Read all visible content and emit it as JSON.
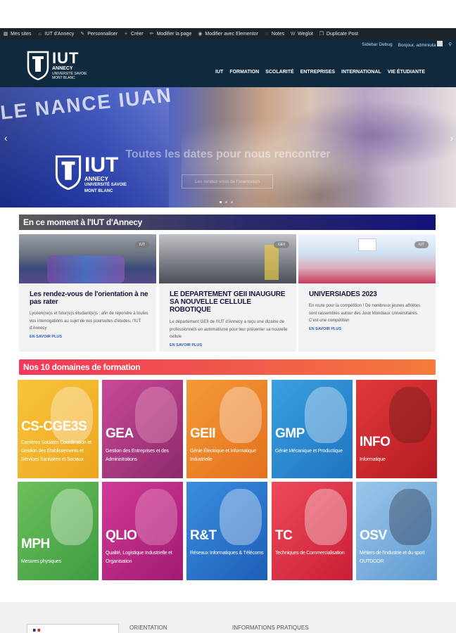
{
  "adminbar": {
    "items": [
      {
        "label": "Mes sites",
        "icon": "sites-icon"
      },
      {
        "label": "IUT d'Annecy",
        "icon": "home-icon"
      },
      {
        "label": "Personnaliser",
        "icon": "brush-icon"
      },
      {
        "label": "Créer",
        "icon": "plus-icon"
      },
      {
        "label": "Modifier la page",
        "icon": "pencil-icon"
      },
      {
        "label": "Modifier avec Elementor",
        "icon": "elementor-icon"
      },
      {
        "label": "Notes",
        "icon": "comment-icon"
      },
      {
        "label": "Weglot",
        "icon": "weglot-icon"
      },
      {
        "label": "Duplicate Post",
        "icon": "copy-icon"
      }
    ]
  },
  "subbar": {
    "debug": "Sidebar Debug",
    "greeting": "Bonjour, adminiuta"
  },
  "logo": {
    "name": "IUT",
    "sub1": "ANNECY",
    "sub2": "UNIVERSITÉ SAVOIE",
    "sub3": "MONT BLANC"
  },
  "nav": [
    "IUT",
    "FORMATION",
    "SCOLARITÉ",
    "ENTREPRISES",
    "INTERNATIONAL",
    "VIE ÉTUDIANTE"
  ],
  "hero": {
    "title": "Toutes les dates pour nous rencontrer",
    "button": "Les rendez-vous de l'orientation",
    "banner": "LE NANCE IUAN",
    "logo_name": "IUT",
    "logo_sub1": "ANNECY",
    "logo_sub2": "UNIVERSITÉ SAVOIE",
    "logo_sub3": "MONT BLANC"
  },
  "news": {
    "heading": "En ce moment à l'IUT d'Annecy",
    "cards": [
      {
        "tag": "IUT",
        "title": "Les rendez-vous de l'orientation à ne pas rater",
        "desc": "Lycéen(ne)s et futur(e)s étudiant(e)s : afin de répondre à toutes vos interrogations au sujet de vos poursuites d'études, l'IUT d'Annecy",
        "more": "EN SAVOIR PLUS"
      },
      {
        "tag": "GEII",
        "title": "LE DEPARTEMENT GEII INAUGURE SA NOUVELLE CELLULE ROBOTIQUE",
        "desc": "Le département GEII de l'IUT d'Annecy a reçu une dizaine de professionnels en automatisme pour leur présenter sa nouvelle cellule",
        "more": "EN SAVOIR PLUS"
      },
      {
        "tag": "IUT",
        "title": "UNIVERSIADES 2023",
        "desc": "En route pour la compétition ! De nombreux jeunes athlètes sont rassemblés autour des Jeux Mondiaux Universitaires. C'est une compétition",
        "more": "EN SAVOIR PLUS"
      }
    ]
  },
  "domains": {
    "heading": "Nos 10 domaines de formation",
    "tiles": [
      {
        "code": "CS-CGE3S",
        "label": "Carrières Sociales Coordination et Gestion des Etablissements et Services Sanitaires et Sociaux",
        "color": "#f4b62a"
      },
      {
        "code": "GEA",
        "label": "Gestion des Entreprises et des Administrations",
        "color": "#b0337e"
      },
      {
        "code": "GEII",
        "label": "Génie Électrique et Informatique Industrielle",
        "color": "#f08a2a"
      },
      {
        "code": "GMP",
        "label": "Génie Mécanique et Productique",
        "color": "#2f8fd8"
      },
      {
        "code": "INFO",
        "label": "Informatique",
        "color": "#d8272e"
      },
      {
        "code": "MPH",
        "label": "Mesures physiques",
        "color": "#55b04f"
      },
      {
        "code": "QLIO",
        "label": "Qualité, Logistique Industrielle et Organisation",
        "color": "#c42a86"
      },
      {
        "code": "R&T",
        "label": "Réseaux Informatiques & Télécoms",
        "color": "#2d78d0"
      },
      {
        "code": "TC",
        "label": "Techniques de Commercialisation",
        "color": "#e43048"
      },
      {
        "code": "OSV",
        "label": "Métiers de l'industrie et du sport OUTDOOR",
        "color": "#7fb2dd"
      }
    ]
  },
  "footer": {
    "col1": "ORIENTATION",
    "col2": "INFORMATIONS PRATIQUES"
  }
}
